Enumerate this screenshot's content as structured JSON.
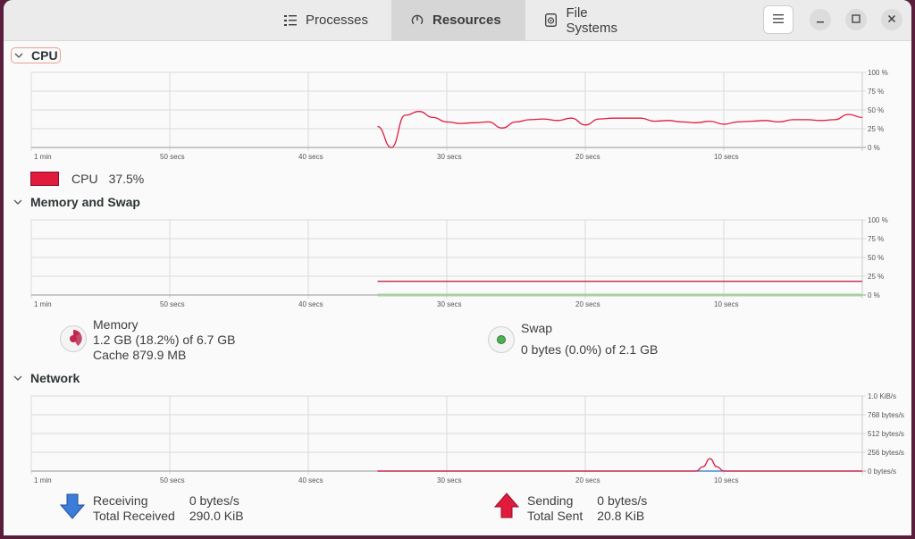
{
  "tabs": [
    {
      "label": "Processes",
      "icon": "list-icon",
      "active": false
    },
    {
      "label": "Resources",
      "icon": "gauge-icon",
      "active": true
    },
    {
      "label": "File Systems",
      "icon": "disk-icon",
      "active": false
    }
  ],
  "window_controls": {
    "menu": "hamburger-menu",
    "minimize": "minimize",
    "maximize": "maximize",
    "close": "close"
  },
  "x_ticks": [
    "1 min",
    "50 secs",
    "40 secs",
    "30 secs",
    "20 secs",
    "10 secs"
  ],
  "cpu": {
    "title": "CPU",
    "y_ticks": [
      "100 %",
      "75 %",
      "50 %",
      "25 %",
      "0 %"
    ],
    "legend_label": "CPU",
    "legend_value": "37.5%",
    "color": "#e01b3c"
  },
  "memory": {
    "title": "Memory and Swap",
    "y_ticks": [
      "100 %",
      "75 %",
      "50 %",
      "25 %",
      "0 %"
    ],
    "memory_label": "Memory",
    "memory_usage": "1.2 GB (18.2%) of 6.7 GB",
    "memory_cache": "Cache 879.9 MB",
    "memory_color": "#c0294d",
    "swap_label": "Swap",
    "swap_usage": "0 bytes (0.0%) of 2.1 GB",
    "swap_color": "#4caf50"
  },
  "network": {
    "title": "Network",
    "y_ticks": [
      "1.0 KiB/s",
      "768 bytes/s",
      "512 bytes/s",
      "256 bytes/s",
      "0 bytes/s"
    ],
    "receiving_label": "Receiving",
    "receiving_value": "0 bytes/s",
    "total_received_label": "Total Received",
    "total_received_value": "290.0 KiB",
    "sending_label": "Sending",
    "sending_value": "0 bytes/s",
    "total_sent_label": "Total Sent",
    "total_sent_value": "20.8 KiB",
    "receive_color": "#3b7dd8",
    "send_color": "#e01b3c"
  },
  "chart_data": [
    {
      "type": "line",
      "title": "CPU",
      "xlabel": "",
      "ylabel": "",
      "x_ticks": [
        "1 min",
        "50 secs",
        "40 secs",
        "30 secs",
        "20 secs",
        "10 secs"
      ],
      "ylim": [
        0,
        100
      ],
      "x_range_secs": [
        60,
        0
      ],
      "series": [
        {
          "name": "CPU",
          "color": "#e01b3c",
          "x": [
            35,
            34,
            33,
            32,
            31,
            30,
            29,
            28,
            27,
            26,
            25,
            24,
            23,
            22,
            21,
            20,
            19,
            18,
            17,
            16,
            15,
            14,
            13,
            12,
            11,
            10,
            9,
            8,
            7,
            6,
            5,
            4,
            3,
            2,
            1,
            0
          ],
          "values": [
            28,
            0,
            43,
            48,
            40,
            34,
            32,
            33,
            34,
            26,
            34,
            37,
            38,
            36,
            39,
            30,
            38,
            39,
            39,
            39,
            35,
            36,
            34,
            33,
            35,
            31,
            34,
            35,
            36,
            34,
            37,
            37,
            36,
            37,
            44,
            40
          ]
        }
      ]
    },
    {
      "type": "line",
      "title": "Memory and Swap",
      "ylim": [
        0,
        100
      ],
      "x_range_secs": [
        60,
        0
      ],
      "series": [
        {
          "name": "Memory",
          "color": "#c0294d",
          "x": [
            35,
            0
          ],
          "values": [
            18.2,
            18.2
          ]
        },
        {
          "name": "Swap",
          "color": "#4caf50",
          "x": [
            35,
            0
          ],
          "values": [
            0,
            0
          ]
        }
      ]
    },
    {
      "type": "line",
      "title": "Network",
      "ylim": [
        0,
        1024
      ],
      "y_unit": "bytes/s",
      "x_range_secs": [
        60,
        0
      ],
      "series": [
        {
          "name": "Receiving",
          "color": "#3b7dd8",
          "x": [
            35,
            0
          ],
          "values": [
            0,
            0
          ]
        },
        {
          "name": "Sending",
          "color": "#e01b3c",
          "x": [
            35,
            12,
            11.5,
            11,
            10.5,
            10,
            0
          ],
          "values": [
            0,
            0,
            60,
            170,
            60,
            0,
            0
          ]
        }
      ]
    }
  ]
}
